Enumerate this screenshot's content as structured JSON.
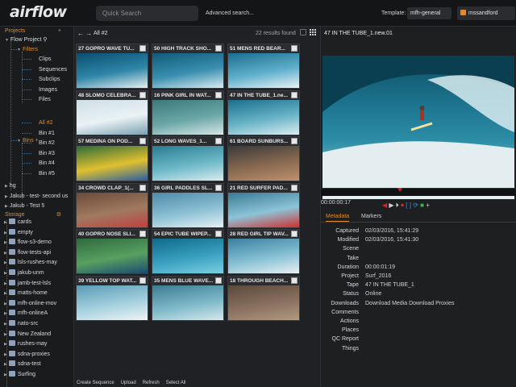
{
  "header": {
    "logo": "airflow",
    "search_placeholder": "Quick Search",
    "advanced": "Advanced search...",
    "template_label": "Template:",
    "template_value": "mfh-general",
    "user": "mssandford"
  },
  "sidebar": {
    "projects_label": "Projects",
    "project_name": "Flow Project",
    "filters_label": "Filters",
    "filters": [
      "Clips",
      "Sequences",
      "Subclips",
      "Images",
      "Files"
    ],
    "bins_label": "Bins",
    "bins": [
      "All #2",
      "Bin #1",
      "Bin #2",
      "Bin #3",
      "Bin #4",
      "Bin #5"
    ],
    "other_projects": [
      "hg",
      "Jakub - test- second us",
      "Jakub - Test 5"
    ],
    "storage_label": "Storage",
    "storage": [
      "cards",
      "empty",
      "flow-s3-demo",
      "flow-tests-api",
      "lsls-rushes-may",
      "jakub-unm",
      "jamb-test-lsls",
      "matts-home",
      "mfh-online-mov",
      "mfh-onlineA",
      "nato-src",
      "New Zealand",
      "rushes-may",
      "sdna-proxies",
      "sdna-test",
      "Surfing"
    ]
  },
  "grid": {
    "breadcrumb": "All #2",
    "results": "22 results found",
    "tiles": [
      {
        "title": "27 GOPRO WAVE TU..."
      },
      {
        "title": "50 HIGH TRACK SHO..."
      },
      {
        "title": "51 MENS RED BEAR..."
      },
      {
        "title": "48 SLOMO CELEBRA..."
      },
      {
        "title": "16 PINK GIRL IN WAT..."
      },
      {
        "title": "47 IN THE TUBE_1.ne..."
      },
      {
        "title": "57 MEDINA ON POD..."
      },
      {
        "title": "52 LONG WAVES_1..."
      },
      {
        "title": "61 BOARD SUNBURS..."
      },
      {
        "title": "34 CROWD CLAP_1(..."
      },
      {
        "title": "36 GIRL PADDLES SL..."
      },
      {
        "title": "21 RED SURFER PAD..."
      },
      {
        "title": "40 GOPRO NOSE SLI..."
      },
      {
        "title": "54 EPIC TUBE WIPEP..."
      },
      {
        "title": "28 RED GIRL TIP WAV..."
      },
      {
        "title": "39 YELLOW TOP WAT..."
      },
      {
        "title": "35 MENS BLUE WAVE..."
      },
      {
        "title": "18 THROUGH BEACH..."
      }
    ],
    "footer": [
      "Create Sequence",
      "Upload",
      "Refresh",
      "Select All"
    ]
  },
  "viewer": {
    "title": "47 IN THE TUBE_1.new.01",
    "timecode": "00:00:00:17",
    "tabs": [
      "Metadata",
      "Markers"
    ]
  },
  "metadata": [
    {
      "k": "Captured",
      "v": "02/03/2016, 15:41:29"
    },
    {
      "k": "Modified",
      "v": "02/03/2016, 15:41:30"
    },
    {
      "k": "Scene",
      "v": ""
    },
    {
      "k": "Take",
      "v": ""
    },
    {
      "k": "Duration",
      "v": "00:00:01:19"
    },
    {
      "k": "Project",
      "v": "Surf_2016"
    },
    {
      "k": "Tape",
      "v": "47 IN THE TUBE_1"
    },
    {
      "k": "Status",
      "v": "Online"
    },
    {
      "k": "Downloads",
      "v": "Download Media    Download Proxies"
    },
    {
      "k": "Comments",
      "v": ""
    },
    {
      "k": "Actions",
      "v": ""
    },
    {
      "k": "Places",
      "v": ""
    },
    {
      "k": "QC Report",
      "v": ""
    },
    {
      "k": "Things",
      "v": ""
    }
  ]
}
